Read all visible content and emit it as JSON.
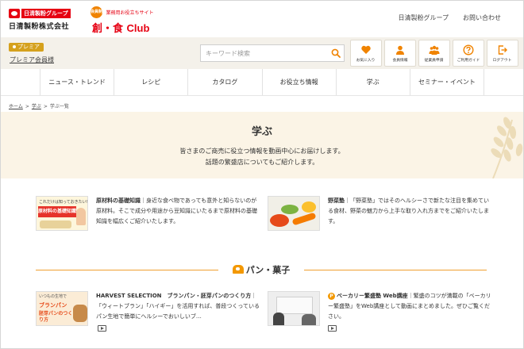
{
  "header": {
    "brand_tag": "日清製粉グループ",
    "brand_name": "日清製粉株式会社",
    "club_badge": "会員制",
    "club_sub": "業務用お役立ちサイト",
    "club_title_jp": "創・食",
    "club_title_en": "Club",
    "links": [
      "日清製粉グループ",
      "お問い合わせ"
    ]
  },
  "member_bar": {
    "premia_badge": "プレミア",
    "premia_link": "プレミア会員様",
    "search_placeholder": "キーワード検索",
    "icons": [
      {
        "label": "お気に入り",
        "icon": "heart-icon"
      },
      {
        "label": "会員情報",
        "icon": "user-icon"
      },
      {
        "label": "従業員申請",
        "icon": "group-icon"
      },
      {
        "label": "ご利用ガイド",
        "icon": "question-icon"
      },
      {
        "label": "ログアウト",
        "icon": "logout-icon"
      }
    ],
    "accent": "#f08300"
  },
  "nav": [
    "ニュース・トレンド",
    "レシピ",
    "カタログ",
    "お役立ち情報",
    "学ぶ",
    "セミナー・イベント"
  ],
  "breadcrumb": {
    "home": "ホーム",
    "learn": "学ぶ",
    "current": "学ぶ一覧",
    "sep": ">"
  },
  "hero": {
    "title": "学ぶ",
    "desc1": "皆さまのご商売に役立つ情報を動画中心にお届けします。",
    "desc2": "話題の繁盛店についてもご紹介します。"
  },
  "features": [
    {
      "thumb_text1": "これだけは知っておきたい!",
      "thumb_text2": "原材料の基礎知識",
      "title": "原材料の基礎知識",
      "body": "｜身近な食べ物であっても意外と知らないのが原材料。そこで成分や用途から豆知識にいたるまで原材料の基礎知識を幅広くご紹介いたします。"
    },
    {
      "title": "野菜塾",
      "body": "｜「野菜塾」ではそのヘルシーさで新たな注目を集めている食材、野菜の魅力から上手な取り入れ方までをご紹介いたします。"
    }
  ],
  "section": {
    "title": "パン・菓子"
  },
  "items": [
    {
      "thumb_text1": "いつもの生地で",
      "thumb_text2": "ブランパン",
      "thumb_text3": "胚芽パンのつくり方",
      "title": "HARVEST SELECTION　ブランパン・胚芽パンのつくり方",
      "body": "｜「ウィートブラン」「ハイギー」を活用すれば、普段つくっているパン生地で簡単にヘルシーでおいしいブ…"
    },
    {
      "badge": "P",
      "title": "ベーカリー繁盛塾 Web講座",
      "body": "｜繁盛のコツが満載の「ベーカリー繁盛塾」をWeb講座として動画にまとめました。ぜひご覧ください。"
    }
  ]
}
